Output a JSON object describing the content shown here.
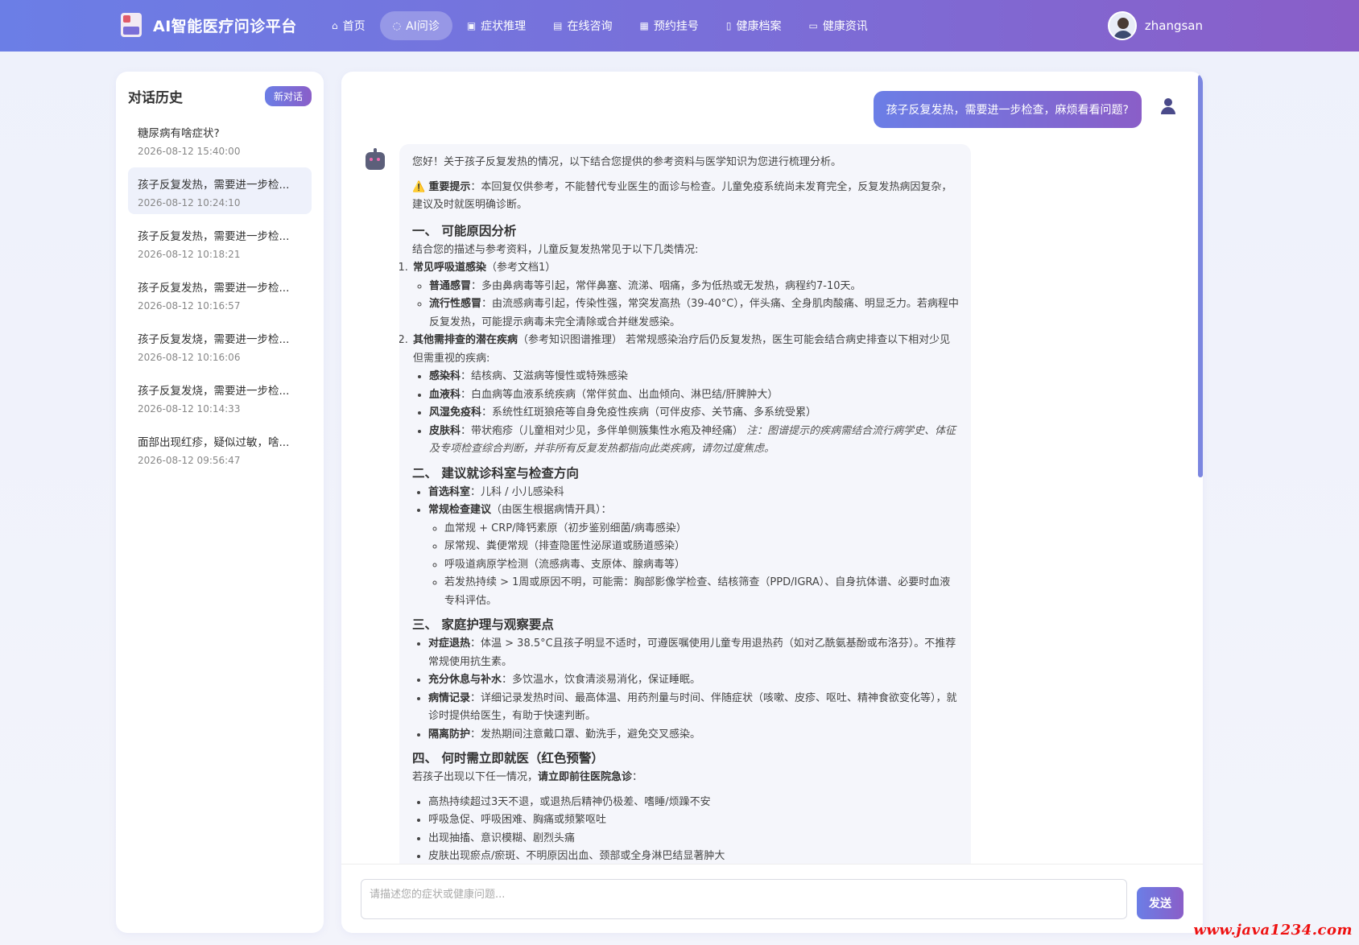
{
  "app": {
    "brand_title": "AI智能医疗问诊平台",
    "username": "zhangsan"
  },
  "nav": [
    {
      "label": "首页",
      "icon": "home-icon",
      "glyph": "⌂"
    },
    {
      "label": "AI问诊",
      "icon": "chat-icon",
      "glyph": "◌"
    },
    {
      "label": "症状推理",
      "icon": "robot-icon",
      "glyph": "▣"
    },
    {
      "label": "在线咨询",
      "icon": "document-icon",
      "glyph": "▤"
    },
    {
      "label": "预约挂号",
      "icon": "calendar-icon",
      "glyph": "▦"
    },
    {
      "label": "健康档案",
      "icon": "file-icon",
      "glyph": "▯"
    },
    {
      "label": "健康资讯",
      "icon": "book-icon",
      "glyph": "▭"
    }
  ],
  "sidebar": {
    "title": "对话历史",
    "new_chat": "新对话",
    "items": [
      {
        "title": "糖尿病有啥症状?",
        "time": "2026-08-12 15:40:00"
      },
      {
        "title": "孩子反复发热，需要进一步检...",
        "time": "2026-08-12 10:24:10"
      },
      {
        "title": "孩子反复发热，需要进一步检...",
        "time": "2026-08-12 10:18:21"
      },
      {
        "title": "孩子反复发热，需要进一步检...",
        "time": "2026-08-12 10:16:57"
      },
      {
        "title": "孩子反复发烧，需要进一步检...",
        "time": "2026-08-12 10:16:06"
      },
      {
        "title": "孩子反复发烧，需要进一步检...",
        "time": "2026-08-12 10:14:33"
      },
      {
        "title": "面部出现红疹，疑似过敏，啥...",
        "time": "2026-08-12 09:56:47"
      }
    ]
  },
  "chat": {
    "user_message": "孩子反复发热，需要进一步检查，麻烦看看问题?",
    "bot": {
      "intro": "您好！关于孩子反复发热的情况，以下结合您提供的参考资料与医学知识为您进行梳理分析。",
      "warn_icon": "⚠️",
      "warn_label": "重要提示",
      "warn_text": "：本回复仅供参考，不能替代专业医生的面诊与检查。儿童免疫系统尚未发育完全，反复发热病因复杂，建议及时就医明确诊断。",
      "s1_title": "一、 可能原因分析",
      "s1_intro": "结合您的描述与参考资料，儿童反复发热常见于以下几类情况:",
      "s1_o1_label": "常见呼吸道感染",
      "s1_o1_ref": "（参考文档1）",
      "s1_o1_a_label": "普通感冒",
      "s1_o1_a_text": "：多由鼻病毒等引起，常伴鼻塞、流涕、咽痛，多为低热或无发热，病程约7-10天。",
      "s1_o1_b_label": "流行性感冒",
      "s1_o1_b_text": "：由流感病毒引起，传染性强，常突发高热（39-40°C），伴头痛、全身肌肉酸痛、明显乏力。若病程中反复发热，可能提示病毒未完全清除或合并继发感染。",
      "s1_o2_label": "其他需排查的潜在疾病",
      "s1_o2_text": "（参考知识图谱推理） 若常规感染治疗后仍反复发热，医生可能会结合病史排查以下相对少见但需重视的疾病:",
      "s1_o2_a_label": "感染科",
      "s1_o2_a_text": "：结核病、艾滋病等慢性或特殊感染",
      "s1_o2_b_label": "血液科",
      "s1_o2_b_text": "：白血病等血液系统疾病（常伴贫血、出血倾向、淋巴结/肝脾肿大）",
      "s1_o2_c_label": "风湿免疫科",
      "s1_o2_c_text": "：系统性红斑狼疮等自身免疫性疾病（可伴皮疹、关节痛、多系统受累）",
      "s1_o2_d_label": "皮肤科",
      "s1_o2_d_text": "：带状疱疹（儿童相对少见，多伴单侧簇集性水疱及神经痛）",
      "s1_o2_d_note": "注：图谱提示的疾病需结合流行病学史、体征及专项检查综合判断，并非所有反复发热都指向此类疾病，请勿过度焦虑。",
      "s2_title": "二、 建议就诊科室与检查方向",
      "s2_a_label": "首选科室",
      "s2_a_text": "：儿科 / 小儿感染科",
      "s2_b_label": "常规检查建议",
      "s2_b_text": "（由医生根据病情开具）：",
      "s2_b_items": [
        "血常规 + CRP/降钙素原（初步鉴别细菌/病毒感染）",
        "尿常规、粪便常规（排查隐匿性泌尿道或肠道感染）",
        "呼吸道病原学检测（流感病毒、支原体、腺病毒等）",
        "若发热持续 > 1周或原因不明，可能需：胸部影像学检查、结核筛查（PPD/IGRA）、自身抗体谱、必要时血液专科评估。"
      ],
      "s3_title": "三、 家庭护理与观察要点",
      "s3_a_label": "对症退热",
      "s3_a_text": "：体温 > 38.5°C且孩子明显不适时，可遵医嘱使用儿童专用退热药（如对乙酰氨基酚或布洛芬）。不推荐常规使用抗生素。",
      "s3_b_label": "充分休息与补水",
      "s3_b_text": "：多饮温水，饮食清淡易消化，保证睡眠。",
      "s3_c_label": "病情记录",
      "s3_c_text": "：详细记录发热时间、最高体温、用药剂量与时间、伴随症状（咳嗽、皮疹、呕吐、精神食欲变化等），就诊时提供给医生，有助于快速判断。",
      "s3_d_label": "隔离防护",
      "s3_d_text": "：发热期间注意戴口罩、勤洗手，避免交叉感染。",
      "s4_title": "四、 何时需立即就医（红色预警）",
      "s4_intro_a": "若孩子出现以下任一情况，",
      "s4_intro_b": "请立即前往医院急诊",
      "s4_intro_c": "：",
      "s4_items": [
        "高热持续超过3天不退，或退热后精神仍极差、嗜睡/烦躁不安",
        "呼吸急促、呼吸困难、胸痛或频繁呕吐",
        "出现抽搐、意识模糊、剧烈头痛",
        "皮肤出现瘀点/瘀斑、不明原因出血、颈部或全身淋巴结显著肿大"
      ]
    },
    "input_placeholder": "请描述您的症状或健康问题...",
    "send_label": "发送"
  },
  "watermark": "www.java1234.com"
}
